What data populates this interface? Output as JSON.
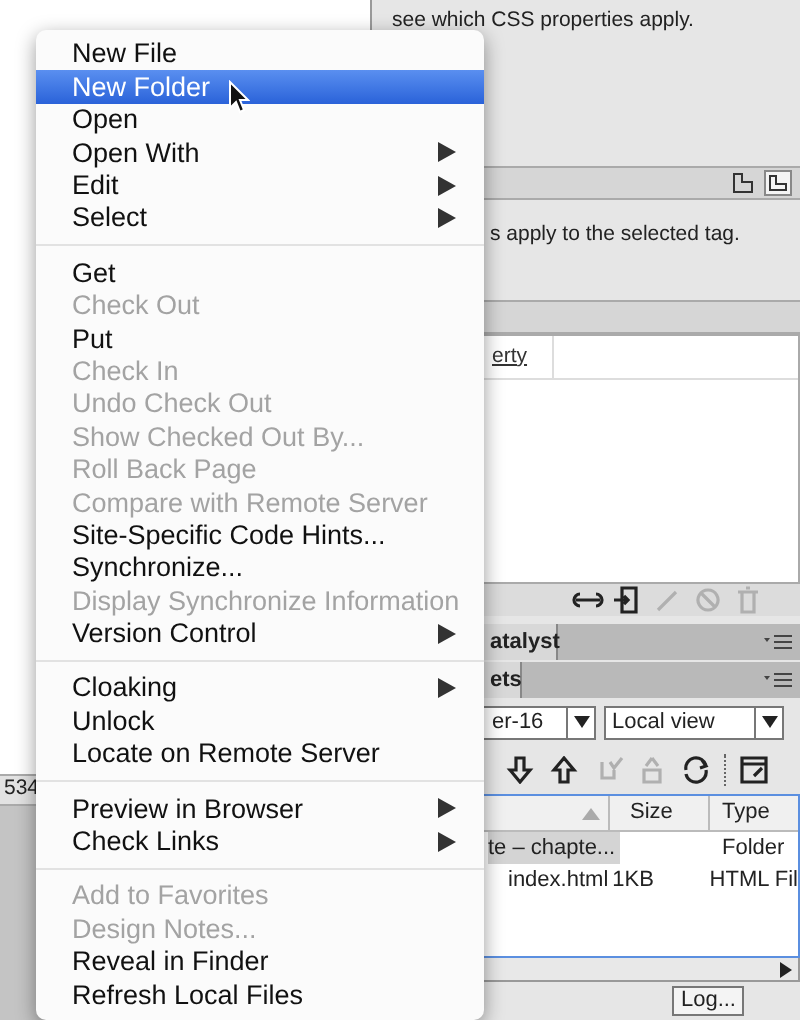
{
  "context_menu": {
    "groups": [
      [
        {
          "label": "New File",
          "selected": false,
          "disabled": false,
          "submenu": false
        },
        {
          "label": "New Folder",
          "selected": true,
          "disabled": false,
          "submenu": false
        },
        {
          "label": "Open",
          "selected": false,
          "disabled": false,
          "submenu": false
        },
        {
          "label": "Open With",
          "selected": false,
          "disabled": false,
          "submenu": true
        },
        {
          "label": "Edit",
          "selected": false,
          "disabled": false,
          "submenu": true
        },
        {
          "label": "Select",
          "selected": false,
          "disabled": false,
          "submenu": true
        }
      ],
      [
        {
          "label": "Get",
          "selected": false,
          "disabled": false,
          "submenu": false
        },
        {
          "label": "Check Out",
          "selected": false,
          "disabled": true,
          "submenu": false
        },
        {
          "label": "Put",
          "selected": false,
          "disabled": false,
          "submenu": false
        },
        {
          "label": "Check In",
          "selected": false,
          "disabled": true,
          "submenu": false
        },
        {
          "label": "Undo Check Out",
          "selected": false,
          "disabled": true,
          "submenu": false
        },
        {
          "label": "Show Checked Out By...",
          "selected": false,
          "disabled": true,
          "submenu": false
        },
        {
          "label": "Roll Back Page",
          "selected": false,
          "disabled": true,
          "submenu": false
        },
        {
          "label": "Compare with Remote Server",
          "selected": false,
          "disabled": true,
          "submenu": false
        },
        {
          "label": "Site-Specific Code Hints...",
          "selected": false,
          "disabled": false,
          "submenu": false
        },
        {
          "label": "Synchronize...",
          "selected": false,
          "disabled": false,
          "submenu": false
        },
        {
          "label": "Display Synchronize Information",
          "selected": false,
          "disabled": true,
          "submenu": false
        },
        {
          "label": "Version Control",
          "selected": false,
          "disabled": false,
          "submenu": true
        }
      ],
      [
        {
          "label": "Cloaking",
          "selected": false,
          "disabled": false,
          "submenu": true
        },
        {
          "label": "Unlock",
          "selected": false,
          "disabled": false,
          "submenu": false
        },
        {
          "label": "Locate on Remote Server",
          "selected": false,
          "disabled": false,
          "submenu": false
        }
      ],
      [
        {
          "label": "Preview in Browser",
          "selected": false,
          "disabled": false,
          "submenu": true
        },
        {
          "label": "Check Links",
          "selected": false,
          "disabled": false,
          "submenu": true
        }
      ],
      [
        {
          "label": "Add to Favorites",
          "selected": false,
          "disabled": true,
          "submenu": false
        },
        {
          "label": "Design Notes...",
          "selected": false,
          "disabled": true,
          "submenu": false
        },
        {
          "label": "Reveal in Finder",
          "selected": false,
          "disabled": false,
          "submenu": false
        },
        {
          "label": "Refresh Local Files",
          "selected": false,
          "disabled": false,
          "submenu": false
        }
      ]
    ]
  },
  "css_panel": {
    "message": "see which CSS properties apply.",
    "rules_message": "s apply to the selected tag.",
    "property_link": "erty"
  },
  "panel_tabs": [
    {
      "label": "atalyst"
    },
    {
      "label": "ets"
    }
  ],
  "files_panel": {
    "site_dropdown": "er-16",
    "view_dropdown": "Local view",
    "columns": [
      "Size",
      "Type"
    ],
    "rows": [
      {
        "name": "te – chapte...",
        "type": "Folder",
        "selected": true
      },
      {
        "name": "index.html",
        "size": "1KB",
        "type": "HTML Fil",
        "selected": false
      }
    ],
    "log_button": "Log..."
  },
  "status_number": "534"
}
